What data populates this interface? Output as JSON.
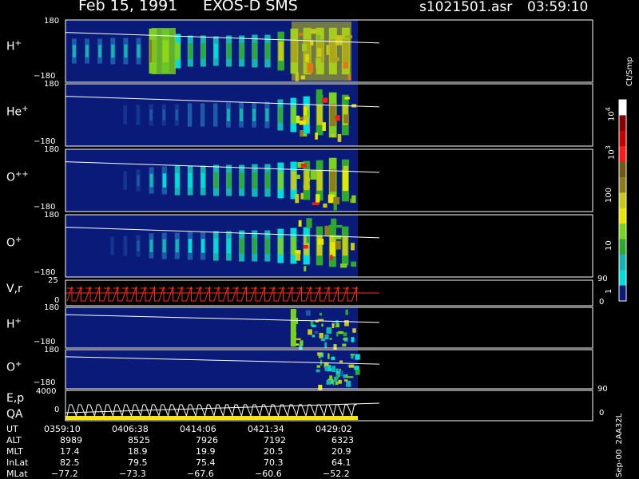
{
  "header": {
    "date": "Feb 15, 1991",
    "mission": "EXOS-D SMS",
    "file": "s1021501.asr",
    "time": "03:59:10"
  },
  "colors": {
    "background": "#000000",
    "panel_background": "#0a1a78",
    "trace": "#ffffff",
    "velocity": "#ff2a1a",
    "qa_band": "#ffe600"
  },
  "panels": [
    {
      "id": "h_plus",
      "label": "H",
      "sup": "+",
      "ymax": "180",
      "ymin": "−180"
    },
    {
      "id": "he_plus",
      "label": "He",
      "sup": "+",
      "ymax": "180",
      "ymin": "−180"
    },
    {
      "id": "o_plusplus",
      "label": "O",
      "sup": "++",
      "ymax": "180",
      "ymin": "−180"
    },
    {
      "id": "o_plus",
      "label": "O",
      "sup": "+",
      "ymax": "180",
      "ymin": "−180"
    },
    {
      "id": "vr",
      "label": "V,r",
      "sup": "",
      "ymax": "25",
      "ymin": "0",
      "rmax": "90",
      "rmin": "0"
    },
    {
      "id": "h_plus_2",
      "label": "H",
      "sup": "+",
      "ymax": "180",
      "ymin": "−180"
    },
    {
      "id": "o_plus_2",
      "label": "O",
      "sup": "+",
      "ymax": "180",
      "ymin": "−180"
    },
    {
      "id": "ep",
      "label": "E,p",
      "sup": "",
      "ymax": "4000",
      "ymin": "0",
      "rmax": "90",
      "rmin": "0"
    },
    {
      "id": "qa",
      "label": "QA",
      "sup": ""
    }
  ],
  "colorbar": {
    "unit": "Ct/Smp",
    "ticks": [
      {
        "base": "10",
        "exp": "4"
      },
      {
        "base": "10",
        "exp": "3"
      },
      {
        "base": "100",
        "exp": ""
      },
      {
        "base": "10",
        "exp": ""
      },
      {
        "base": "1",
        "exp": ""
      }
    ],
    "stops": [
      "#ffffff",
      "#8a0000",
      "#c40000",
      "#ff1a1a",
      "#6e5a12",
      "#8c7d1a",
      "#c8c81a",
      "#e6e600",
      "#7ad21e",
      "#2ea82e",
      "#14b4b4",
      "#00dcdc",
      "#0a1a78"
    ]
  },
  "footer_code": "Sep-00  2AA32L",
  "ephemeris": {
    "rows": [
      {
        "name": "UT",
        "values": [
          "0359:10",
          "0406:38",
          "0414:06",
          "0421:34",
          "0429:02"
        ]
      },
      {
        "name": "ALT",
        "values": [
          "8989",
          "8525",
          "7926",
          "7192",
          "6323"
        ]
      },
      {
        "name": "MLT",
        "values": [
          "17.4",
          "18.9",
          "19.9",
          "20.5",
          "20.9"
        ]
      },
      {
        "name": "InLat",
        "values": [
          "82.5",
          "79.5",
          "75.4",
          "70.3",
          "64.1"
        ]
      },
      {
        "name": "MLat",
        "values": [
          "−77.2",
          "−73.3",
          "−67.6",
          "−60.6",
          "−52.2"
        ]
      }
    ]
  },
  "chart_data": {
    "type": "heatmap",
    "title": "Feb 15, 1991   EXOS-D SMS",
    "x_ticks_ut": [
      "0359:10",
      "0406:38",
      "0414:06",
      "0421:34",
      "0429:02"
    ],
    "xlim_ut": [
      "0359:10",
      "0435:00"
    ],
    "data_end_ut": "0431:00",
    "series": [
      {
        "name": "H+",
        "ylim": [
          -180,
          180
        ],
        "stripes": 22,
        "intensity_profile": [
          0.3,
          0.3,
          0.3,
          0.35,
          0.35,
          0.35,
          0.9,
          0.95,
          0.9,
          0.6,
          0.5,
          0.5,
          0.45,
          0.45,
          0.5,
          0.5,
          0.55,
          0.55,
          0.7,
          0.75,
          0.95,
          1.0,
          1.0,
          1.0,
          1.0
        ]
      },
      {
        "name": "He+",
        "ylim": [
          -180,
          180
        ],
        "intensity_profile": [
          0.0,
          0.0,
          0.0,
          0.05,
          0.1,
          0.15,
          0.2,
          0.2,
          0.2,
          0.2,
          0.25,
          0.25,
          0.25,
          0.25,
          0.3,
          0.3,
          0.3,
          0.35,
          0.4,
          0.5,
          0.6,
          0.7,
          0.8,
          0.95,
          0.8
        ]
      },
      {
        "name": "O++",
        "ylim": [
          -180,
          180
        ],
        "intensity_profile": [
          0.0,
          0.0,
          0.0,
          0.05,
          0.1,
          0.2,
          0.3,
          0.35,
          0.4,
          0.45,
          0.45,
          0.45,
          0.5,
          0.5,
          0.5,
          0.5,
          0.55,
          0.55,
          0.6,
          0.65,
          0.7,
          0.75,
          0.8,
          0.95,
          0.85
        ]
      },
      {
        "name": "O+",
        "ylim": [
          -180,
          180
        ],
        "intensity_profile": [
          0.0,
          0.0,
          0.05,
          0.1,
          0.15,
          0.2,
          0.25,
          0.3,
          0.35,
          0.35,
          0.4,
          0.4,
          0.45,
          0.45,
          0.45,
          0.5,
          0.5,
          0.5,
          0.55,
          0.6,
          0.65,
          0.7,
          0.75,
          0.85,
          0.75
        ]
      },
      {
        "name": "V,r",
        "ylim": [
          0,
          25
        ],
        "right_ylim": [
          0,
          90
        ]
      },
      {
        "name": "H+ (2)",
        "ylim": [
          -180,
          180
        ],
        "active_from_fraction": 0.77
      },
      {
        "name": "O+ (2)",
        "ylim": [
          -180,
          180
        ],
        "active_from_fraction": 0.85
      },
      {
        "name": "E,p",
        "ylim": [
          0,
          4000
        ],
        "right_ylim": [
          0,
          90
        ]
      }
    ],
    "colorbar_range": [
      1,
      10000
    ],
    "colorbar_scale": "log",
    "colorbar_label": "Ct/Smp"
  }
}
